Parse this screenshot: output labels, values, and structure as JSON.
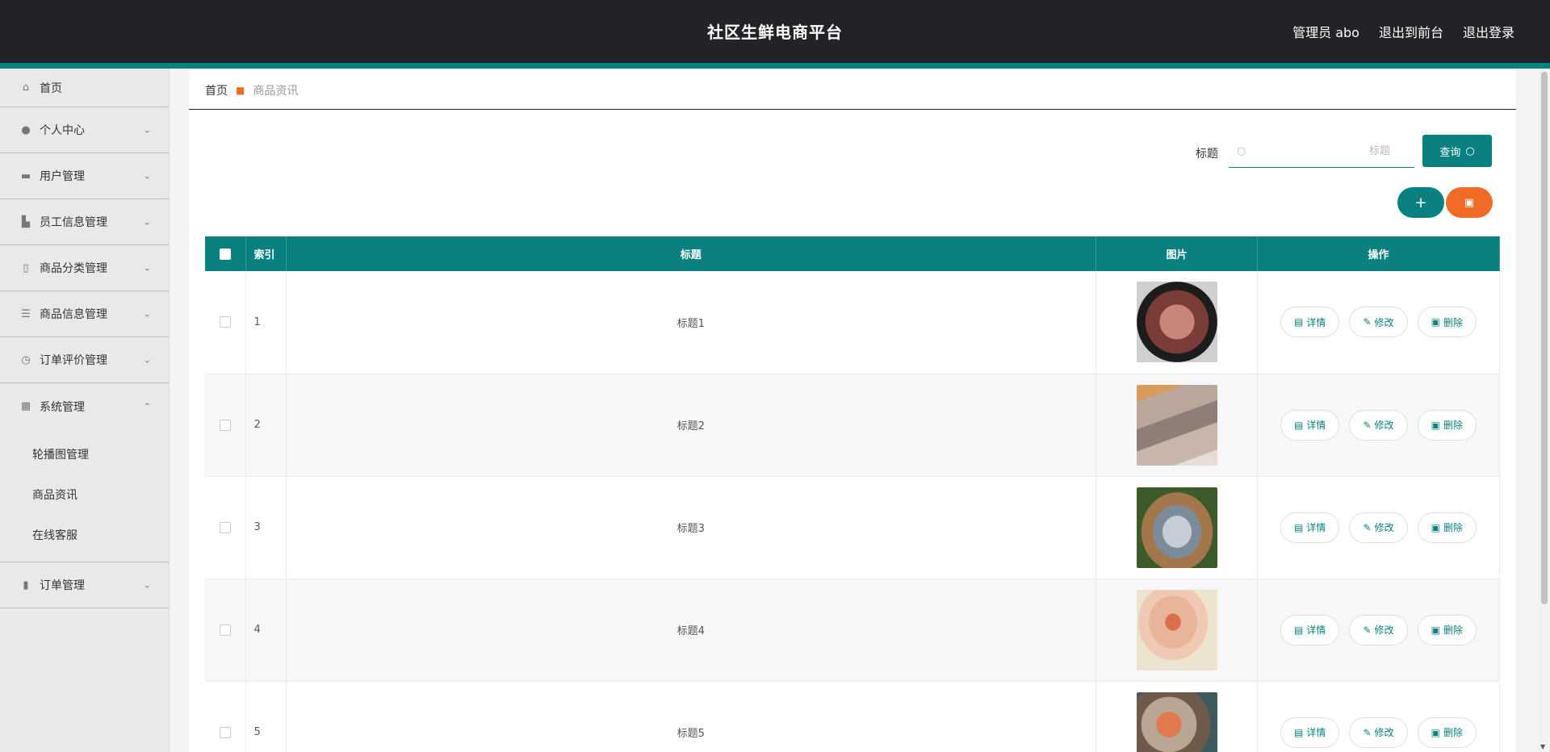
{
  "header": {
    "title": "社区生鲜电商平台",
    "user_label": "管理员 abo",
    "front_label": "退出到前台",
    "logout_label": "退出登录"
  },
  "sidebar": {
    "items": [
      {
        "label": "首页",
        "icon": "home-icon"
      },
      {
        "label": "个人中心",
        "icon": "user-icon"
      },
      {
        "label": "用户管理",
        "icon": "users-icon"
      },
      {
        "label": "员工信息管理",
        "icon": "staff-icon"
      },
      {
        "label": "商品分类管理",
        "icon": "category-icon"
      },
      {
        "label": "商品信息管理",
        "icon": "list-icon"
      },
      {
        "label": "订单评价管理",
        "icon": "compass-icon"
      },
      {
        "label": "系统管理",
        "icon": "grid-icon"
      },
      {
        "label": "订单管理",
        "icon": "chart-icon"
      }
    ],
    "sub_items": [
      "轮播图管理",
      "商品资讯",
      "在线客服"
    ]
  },
  "breadcrumb": {
    "home": "首页",
    "current": "商品资讯"
  },
  "search": {
    "label": "标题",
    "placeholder": "标题",
    "button_label": "查询"
  },
  "table": {
    "headers": {
      "index": "索引",
      "title": "标题",
      "image": "图片",
      "actions": "操作"
    },
    "rows": [
      {
        "index": "1",
        "title": "标题1",
        "image": "sliced-meat"
      },
      {
        "index": "2",
        "title": "标题2",
        "image": "shrimp"
      },
      {
        "index": "3",
        "title": "标题3",
        "image": "fish"
      },
      {
        "index": "4",
        "title": "标题4",
        "image": "cake"
      },
      {
        "index": "5",
        "title": "标题5",
        "image": "seafood"
      }
    ],
    "actions": {
      "detail": "详情",
      "edit": "修改",
      "delete": "删除"
    }
  },
  "colors": {
    "accent": "#0b8080",
    "danger": "#f06b26",
    "header_bg": "#232226"
  }
}
